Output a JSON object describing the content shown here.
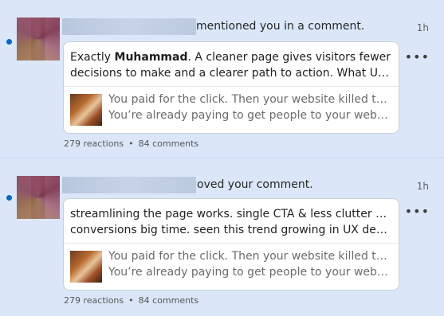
{
  "notifications": [
    {
      "headline": "mentioned you in a comment.",
      "time": "1h",
      "comment_prefix": "Exactly ",
      "comment_bold": "Muhammad",
      "comment_rest": ". A cleaner page gives visitors fewer",
      "comment_line2": "decisions to make and a clearer path to action. What UX chang…",
      "post_line1": "You paid for the click. Then your website killed the sale.",
      "post_line2": "You’re already paying to get people to your website. T…",
      "reactions": "279 reactions",
      "separator": "•",
      "comments": "84 comments"
    },
    {
      "headline": "oved your comment.",
      "time": "1h",
      "comment_line1": "streamlining the page works. single CTA & less clutter boost",
      "comment_line2": "conversions big time. seen this trend growing in UX design too",
      "post_line1": "You paid for the click. Then your website killed the sale.",
      "post_line2": "You’re already paying to get people to your website. T…",
      "reactions": "279 reactions",
      "separator": "•",
      "comments": "84 comments"
    }
  ],
  "more_icon": "•••",
  "icons": {
    "unread": "unread-dot-icon",
    "more": "more-options-icon"
  },
  "colors": {
    "background": "#dbe7f9",
    "unread_dot": "#0a66c2"
  }
}
